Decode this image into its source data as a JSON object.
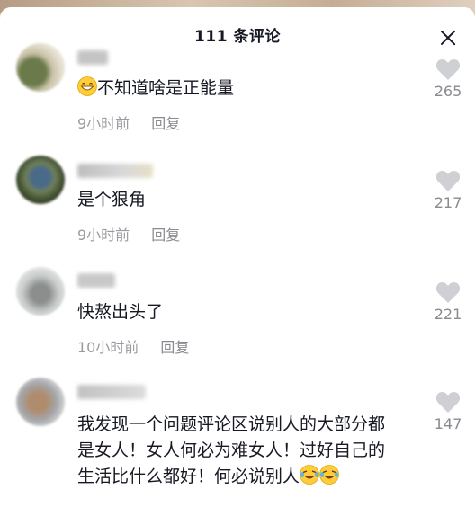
{
  "header": {
    "title": "111 条评论"
  },
  "comments": [
    {
      "text": "不知道啥是正能量",
      "time": "9小时前",
      "reply": "回复",
      "likes": "265"
    },
    {
      "text": "是个狠角",
      "time": "9小时前",
      "reply": "回复",
      "likes": "217"
    },
    {
      "text": "快熬出头了",
      "time": "10小时前",
      "reply": "回复",
      "likes": "221"
    },
    {
      "text": "我发现一个问题评论区说别人的大部分都是女人！女人何必为难女人！过好自己的生活比什么都好！何必说别人",
      "likes": "147"
    }
  ],
  "colors": {
    "text": "#161823",
    "meta": "#9a9ba0",
    "like": "#cfd0d3"
  },
  "icons": [
    "close-icon",
    "heart-icon",
    "grin-emoji-icon",
    "laughing-crying-emoji-icon"
  ]
}
